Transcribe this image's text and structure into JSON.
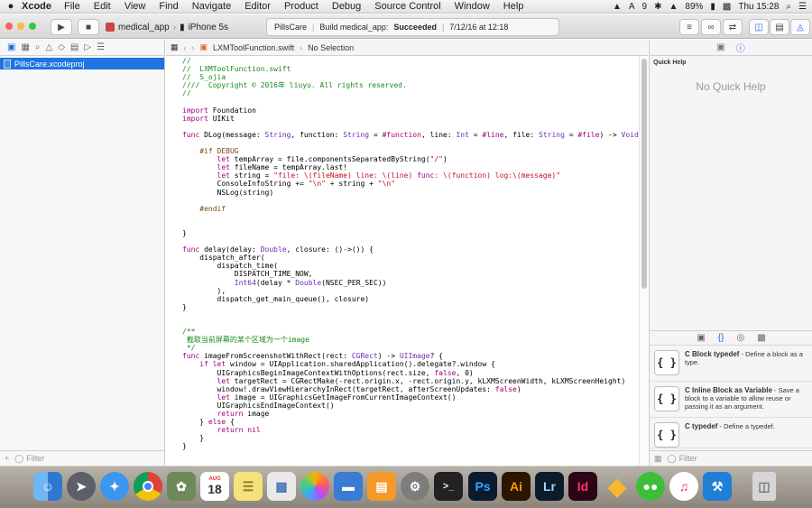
{
  "menubar": {
    "app_name": "Xcode",
    "items": [
      "File",
      "Edit",
      "View",
      "Find",
      "Navigate",
      "Editor",
      "Product",
      "Debug",
      "Source Control",
      "Window",
      "Help"
    ],
    "notification_count": "9",
    "battery": "89%",
    "clock": "Thu 15:28"
  },
  "toolbar": {
    "scheme": "medical_app",
    "device": "iPhone 5s",
    "status_project": "PillsCare",
    "status_message": "Build medical_app:",
    "status_result": "Succeeded",
    "status_time": "7/12/16 at 12:18"
  },
  "navigator": {
    "selected_item": "PillsCare.xcodeproj",
    "filter_placeholder": "Filter"
  },
  "editor": {
    "file_name": "LXMToolFunction.swift",
    "selection": "No Selection",
    "code_lines": [
      "//",
      "//  LXMToolFunction.swift",
      "//  S_ojia",
      "////  Copyright © 2016年 liuyu. All rights reserved.",
      "//",
      "",
      "import Foundation",
      "import UIKit",
      "",
      "func DLog(message: String, function: String = #function, line: Int = #line, file: String = #file) -> Void {",
      "",
      "    #if DEBUG",
      "        let tempArray = file.componentsSeparatedByString(\"/\")",
      "        let fileName = tempArray.last!",
      "        let string = \"file: \\(fileName) line: \\(line) func: \\(function) log:\\(message)\"",
      "        ConsoleInfoString += \"\\n\" + string + \"\\n\"",
      "        NSLog(string)",
      "",
      "    #endif",
      "",
      "",
      "}",
      "",
      "func delay(delay: Double, closure: ()->()) {",
      "    dispatch_after(",
      "        dispatch_time(",
      "            DISPATCH_TIME_NOW,",
      "            Int64(delay * Double(NSEC_PER_SEC))",
      "        ),",
      "        dispatch_get_main_queue(), closure)",
      "}",
      "",
      "",
      "/**",
      " 截取当前屏幕的某个区域为一个image",
      " */",
      "func imageFromScreenshotWithRect(rect: CGRect) -> UIImage? {",
      "    if let window = UIApplication.sharedApplication().delegate?.window {",
      "        UIGraphicsBeginImageContextWithOptions(rect.size, false, 0)",
      "        let targetRect = CGRectMake(-rect.origin.x, -rect.origin.y, kLXMScreenWidth, kLXMScreenHeight)",
      "        window!.drawViewHierarchyInRect(targetRect, afterScreenUpdates: false)",
      "        let image = UIGraphicsGetImageFromCurrentImageContext()",
      "        UIGraphicsEndImageContext()",
      "        return image",
      "    } else {",
      "        return nil",
      "    }",
      "}"
    ]
  },
  "inspector": {
    "quick_help_title": "Quick Help",
    "quick_help_empty": "No Quick Help",
    "filter_placeholder": "Filter",
    "library_items": [
      {
        "title": "C Block typedef",
        "desc": " - Define a block as a type."
      },
      {
        "title": "C Inline Block as Variable",
        "desc": " - Save a block to a variable to allow reuse or passing it as an argument."
      },
      {
        "title": "C typedef",
        "desc": " - Define a typedef."
      }
    ]
  },
  "dock": {
    "apps": [
      "finder",
      "launchpad",
      "safari",
      "chrome",
      "preview-photo",
      "calendar",
      "notes",
      "photos-viewer",
      "photos",
      "keynote",
      "ibooks",
      "system-preferences",
      "terminal",
      "photoshop",
      "illustrator",
      "lightroom",
      "indesign",
      "sketch",
      "wechat",
      "itunes",
      "xcode",
      "trash"
    ],
    "calendar_month": "AUG",
    "calendar_day": "18",
    "labels": {
      "photoshop": "Ps",
      "illustrator": "Ai",
      "lightroom": "Lr",
      "indesign": "Id"
    }
  }
}
